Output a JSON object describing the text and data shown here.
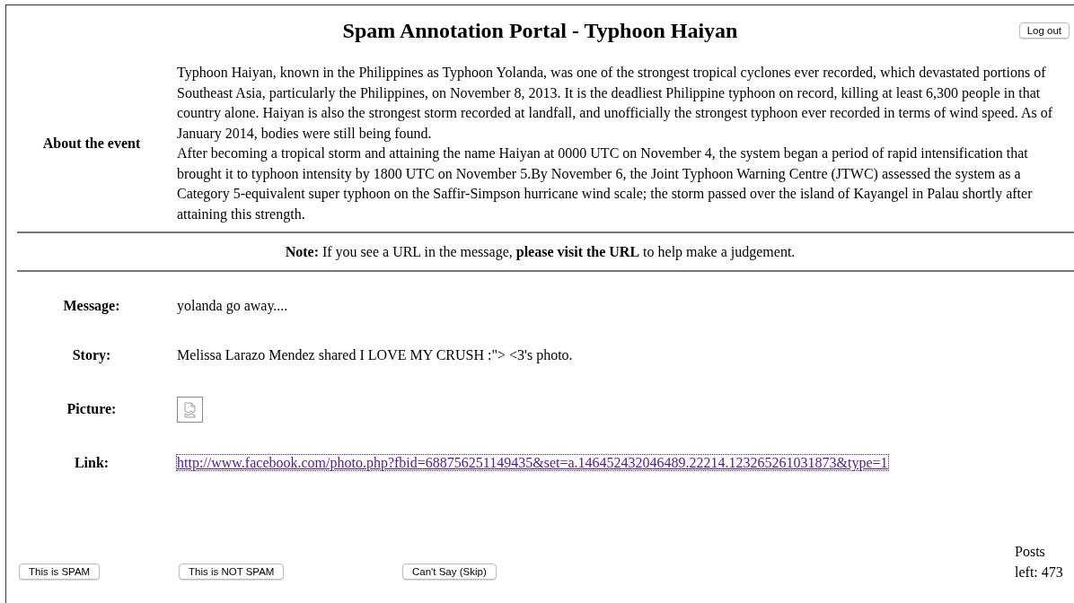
{
  "header": {
    "title": "Spam Annotation Portal - Typhoon Haiyan",
    "logout_button": "Log out"
  },
  "about": {
    "label": "About the event",
    "paragraphs": [
      "Typhoon Haiyan, known in the Philippines as Typhoon Yolanda, was one of the strongest tropical cyclones ever recorded, which devastated portions of Southeast Asia, particularly the Philippines, on November 8, 2013. It is the deadliest Philippine typhoon on record, killing at least 6,300 people in that country alone. Haiyan is also the strongest storm recorded at landfall, and unofficially the strongest typhoon ever recorded in terms of wind speed. As of January 2014, bodies were still being found.",
      "After becoming a tropical storm and attaining the name Haiyan at 0000 UTC on November 4, the system began a period of rapid intensification that brought it to typhoon intensity by 1800 UTC on November 5.By November 6, the Joint Typhoon Warning Centre (JTWC) assessed the system as a Category 5-equivalent super typhoon on the Saffir-Simpson hurricane wind scale; the storm passed over the island of Kayangel in Palau shortly after attaining this strength."
    ]
  },
  "note": "**Note:** If you see a URL in the message, **please visit the URL** to help make a judgement.",
  "fields": [
    {
      "kind": "text",
      "label": "Message:",
      "value": "yolanda go away...."
    },
    {
      "kind": "text",
      "label": "Story:",
      "value": "Melissa Larazo Mendez shared I LOVE MY CRUSH :\"> <3's photo."
    },
    {
      "kind": "image",
      "label": "Picture:",
      "broken": true
    },
    {
      "kind": "link",
      "label": "Link:",
      "value": "http://www.facebook.com/photo.php?fbid=688756251149435&set=a.146452432046489.22214.123265261031873&type=1",
      "visited": true,
      "focused": true
    }
  ],
  "actions": [
    "This is SPAM",
    "This is NOT SPAM",
    "Can't Say (Skip)"
  ],
  "posts_left": {
    "label": "Posts",
    "value": "left: 473"
  }
}
